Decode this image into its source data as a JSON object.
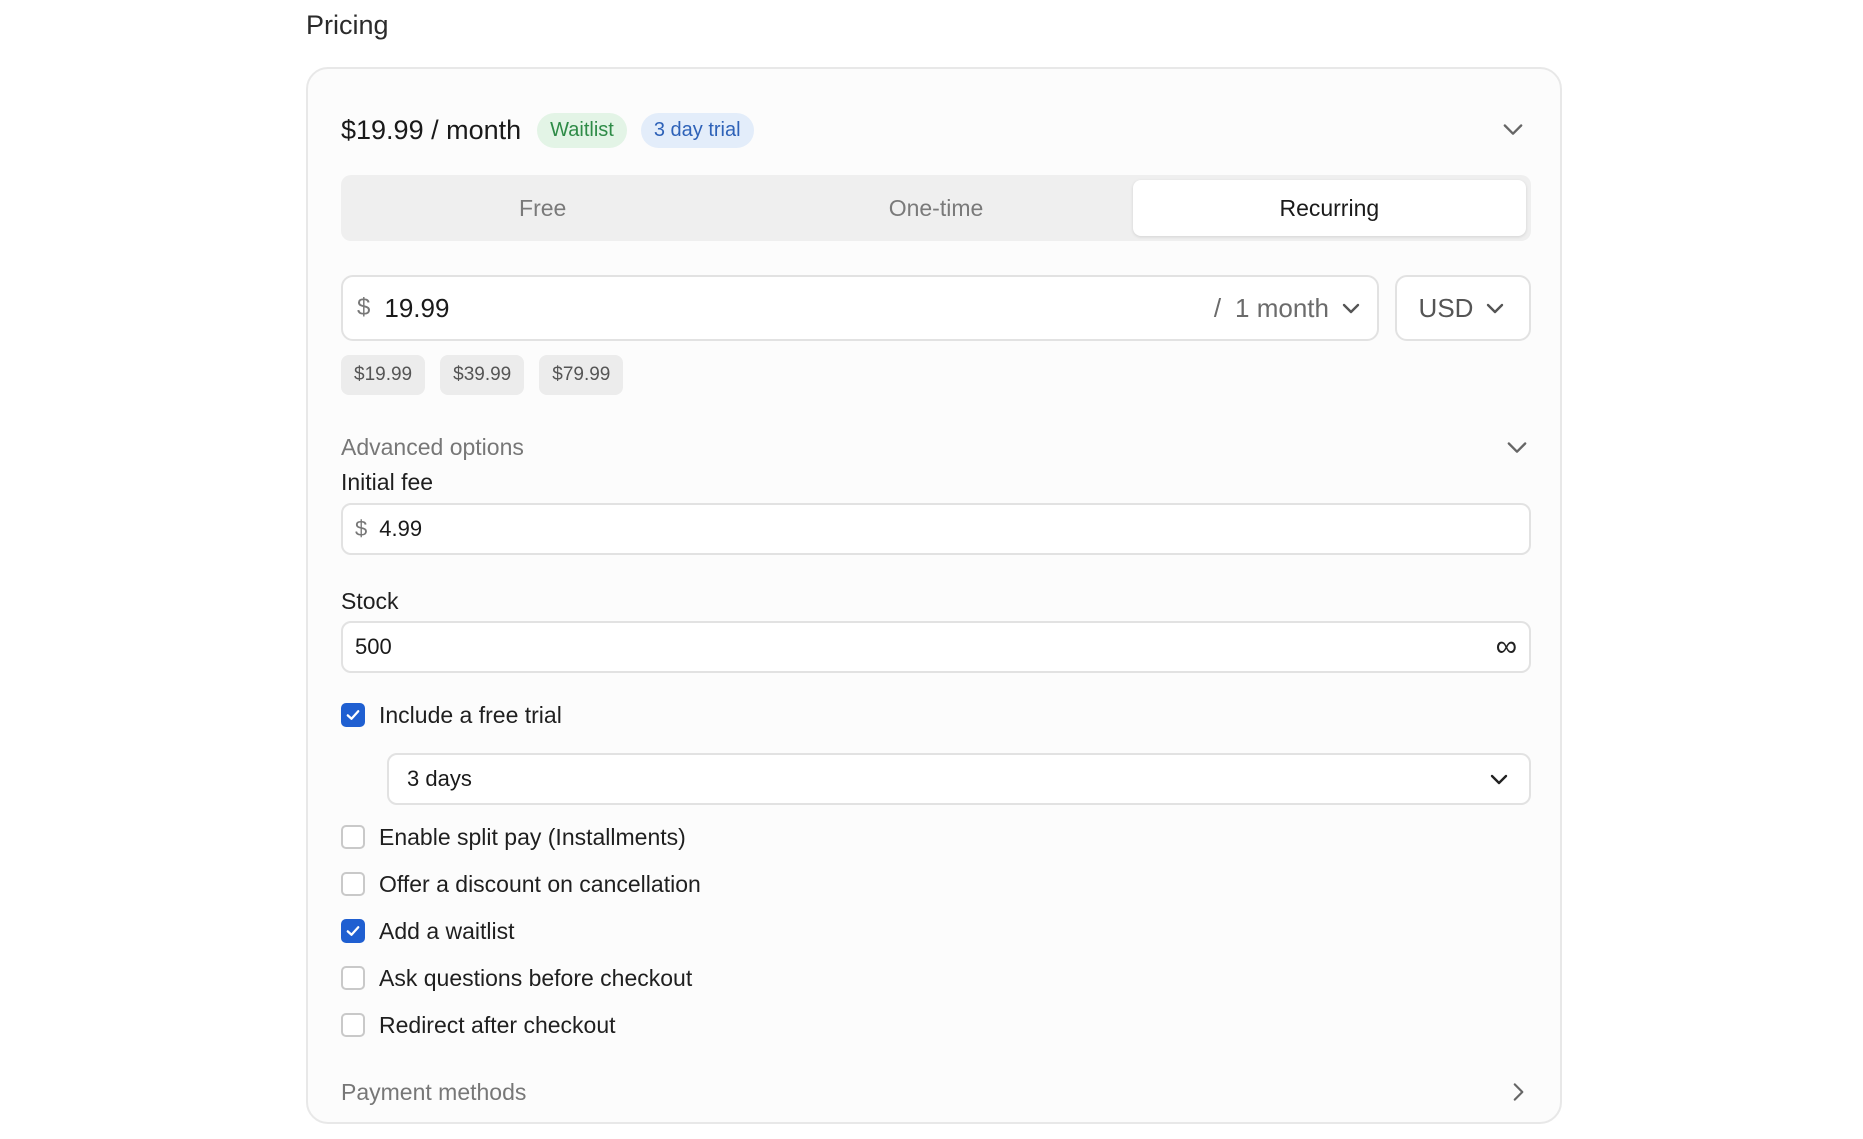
{
  "section": {
    "title": "Pricing"
  },
  "card": {
    "price_summary": "$19.99 / month",
    "badges": [
      "Waitlist",
      "3 day trial"
    ]
  },
  "price_type": {
    "options": [
      "Free",
      "One-time",
      "Recurring"
    ],
    "selected": "Recurring"
  },
  "price": {
    "currency_symbol": "$",
    "value": "19.99",
    "interval_separator": "/",
    "interval": "1 month",
    "currency": "USD"
  },
  "presets": [
    "$19.99",
    "$39.99",
    "$79.99"
  ],
  "advanced": {
    "label": "Advanced options"
  },
  "initial_fee": {
    "label": "Initial fee",
    "currency_symbol": "$",
    "value": "4.99"
  },
  "stock": {
    "label": "Stock",
    "value": "500",
    "unlimited_icon": "∞"
  },
  "options": [
    {
      "label": "Include a free trial",
      "checked": true
    },
    {
      "label": "Enable split pay (Installments)",
      "checked": false
    },
    {
      "label": "Offer a discount on cancellation",
      "checked": false
    },
    {
      "label": "Add a waitlist",
      "checked": true
    },
    {
      "label": "Ask questions before checkout",
      "checked": false
    },
    {
      "label": "Redirect after checkout",
      "checked": false
    }
  ],
  "trial_length": {
    "value": "3 days"
  },
  "payment_methods": {
    "label": "Payment methods"
  },
  "colors": {
    "accent": "#1f5fd1",
    "badge_green": "#2e8b47",
    "badge_blue": "#2e62b8"
  }
}
